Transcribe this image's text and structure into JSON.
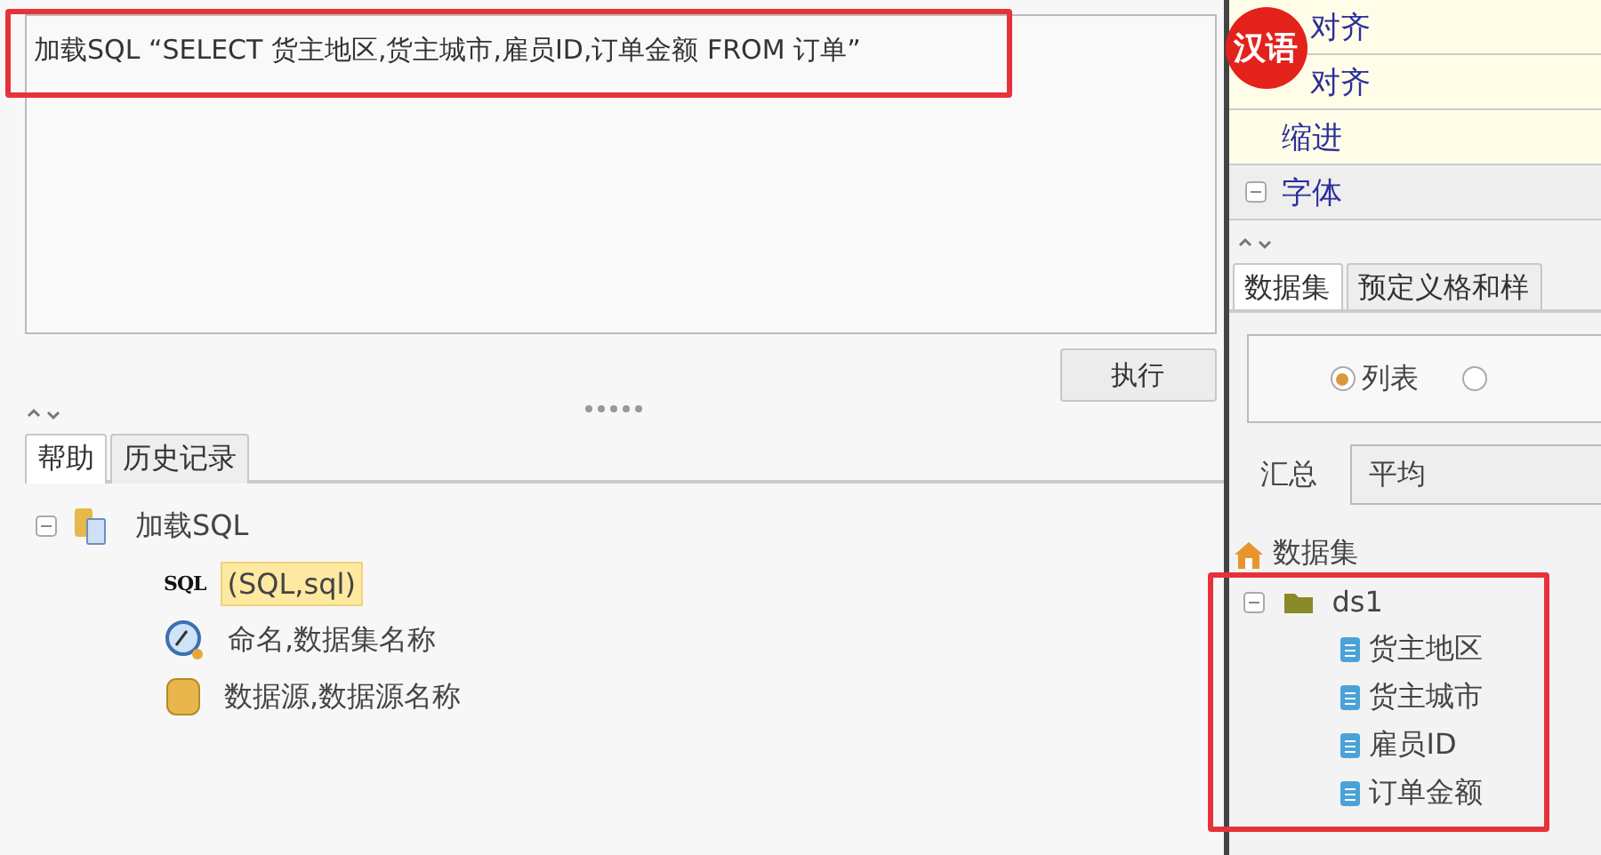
{
  "sql_editor": {
    "value": "加载SQL “SELECT 货主地区,货主城市,雇员ID,订单金额 FROM 订单”",
    "highlighted": true
  },
  "run_button": "执行",
  "help_tabs": [
    {
      "label": "帮助",
      "selected": true
    },
    {
      "label": "历史记录",
      "selected": false
    }
  ],
  "help_tree": [
    {
      "label": "加载SQL",
      "kind": "function",
      "expanded": true,
      "children": [
        {
          "label": "(SQL,sql)",
          "kind": "sql",
          "icon_text": "SQL",
          "selected": true
        },
        {
          "label": "命名,数据集名称",
          "kind": "name",
          "selected": false
        },
        {
          "label": "数据源,数据源名称",
          "kind": "source",
          "selected": false
        }
      ]
    }
  ],
  "properties": [
    {
      "label": "对齐",
      "kind": "leaf"
    },
    {
      "label": "对齐",
      "kind": "leaf"
    },
    {
      "label": "缩进",
      "kind": "leaf"
    },
    {
      "label": "字体",
      "kind": "group"
    }
  ],
  "language_badge": "汉语",
  "side_tabs": [
    {
      "label": "数据集",
      "selected": true
    },
    {
      "label": "预定义格和样",
      "selected": false
    }
  ],
  "view_options": [
    {
      "label": "列表",
      "selected": true
    },
    {
      "selected": false
    }
  ],
  "summary": {
    "label": "汇总",
    "value": "平均"
  },
  "dataset_tree": {
    "label": "数据集",
    "highlighted": true,
    "children": [
      {
        "label": "ds1",
        "expanded": true,
        "children": [
          {
            "label": "货主地区"
          },
          {
            "label": "货主城市"
          },
          {
            "label": "雇员ID"
          },
          {
            "label": "订单金额"
          }
        ]
      }
    ]
  }
}
